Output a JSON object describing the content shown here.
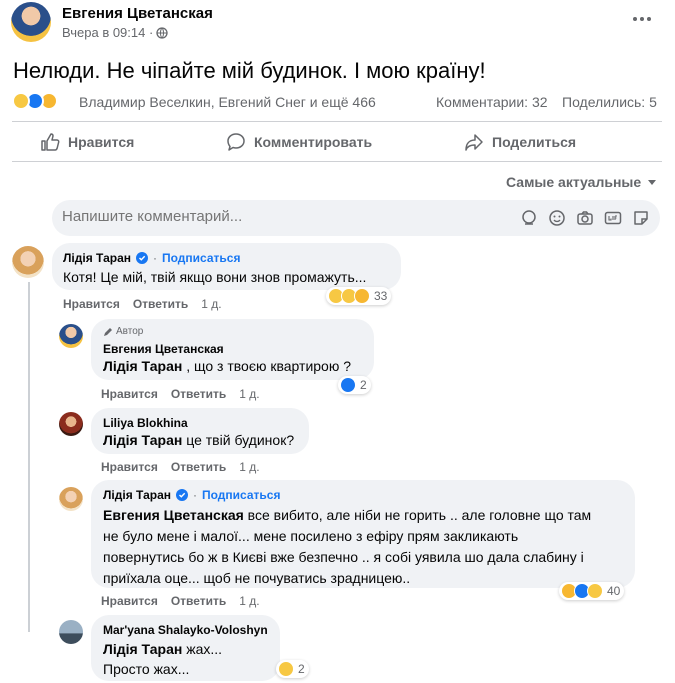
{
  "post": {
    "author": "Евгения Цветанская",
    "time": "Вчера в 09:14 ·",
    "globe_icon": "globe-icon",
    "menu_icon": "more-icon",
    "text": "Нелюди. Не чіпайте мій будинок. І мою країну!",
    "reactions_text": "Владимир Веселкин, Евгений Снег и ещё 466",
    "comments_count": "Комментарии: 32",
    "shares_count": "Поделились: 5"
  },
  "actions": {
    "like": "Нравится",
    "comment": "Комментировать",
    "share": "Поделиться"
  },
  "sort_label": "Самые актуальные",
  "composer": {
    "placeholder": "Напишите комментарий..."
  },
  "comments": [
    {
      "author": "Лідія Таран",
      "follow": "Подписаться",
      "text": "Котя! Це мій, твій якщо вони знов промажуть...",
      "like": "Нравится",
      "reply": "Ответить",
      "time": "1 д.",
      "reactions_count": "33"
    },
    {
      "badge": "Автор",
      "author": "Евгения Цветанская",
      "mention": "Лідія Таран",
      "text": " , що з твоєю квартирою ?",
      "like": "Нравится",
      "reply": "Ответить",
      "time": "1 д.",
      "reactions_count": "2"
    },
    {
      "author": "Liliya Blokhina",
      "mention": "Лідія Таран",
      "text": " це твій будинок?",
      "like": "Нравится",
      "reply": "Ответить",
      "time": "1 д."
    },
    {
      "author": "Лідія Таран",
      "follow": "Подписаться",
      "mention": "Евгения Цветанская",
      "line1": " все вибито, але ніби не горить .. але головне що там",
      "line2": "не було мене і малої... мене посилено з ефіру прям закликають",
      "line3": "повернутись бо ж в Києві вже безпечно .. я собі уявила шо дала слабину і",
      "line4": "приїхала оце... щоб не почуватись зрадницею..",
      "like": "Нравится",
      "reply": "Ответить",
      "time": "1 д.",
      "reactions_count": "40"
    },
    {
      "author": "Mar'yana Shalayko-Voloshyn",
      "mention": "Лідія Таран",
      "text": " жах...",
      "line2": "Просто жах...",
      "like": "Нравится",
      "reply": "Ответить",
      "time": "1 д.",
      "reactions_count": "2"
    }
  ],
  "colors": {
    "accent": "#1877f2",
    "muted": "#65676b",
    "bubble": "#f0f2f5"
  }
}
